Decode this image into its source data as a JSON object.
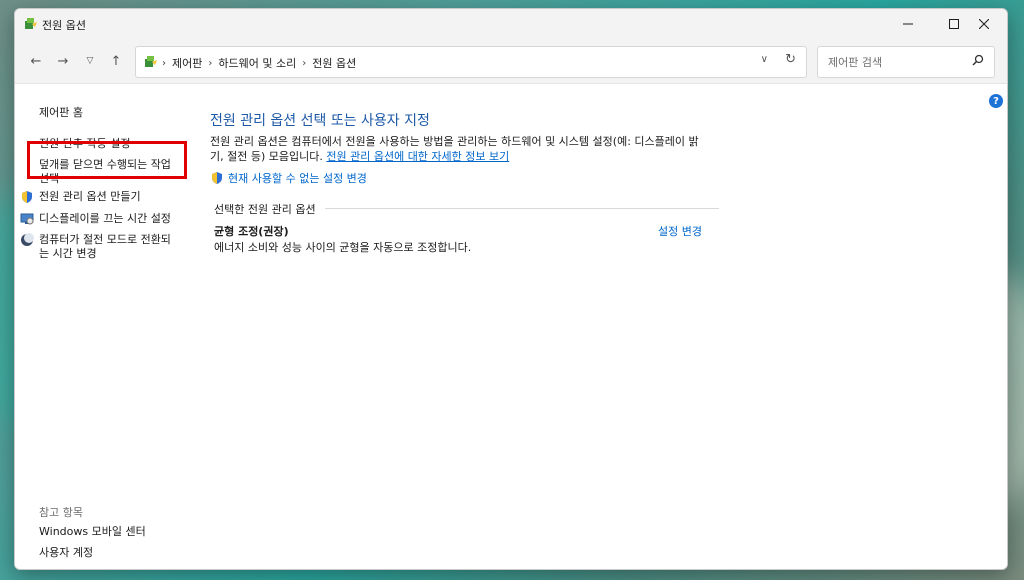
{
  "window": {
    "title": "전원 옵션"
  },
  "address": {
    "crumbs": [
      "제어판",
      "하드웨어 및 소리",
      "전원 옵션"
    ]
  },
  "search": {
    "placeholder": "제어판 검색"
  },
  "sidebar": {
    "home": "제어판 홈",
    "items": [
      {
        "label": "전원 단추 작동 설정"
      },
      {
        "label_line1": "덮개를 닫으면 수행되는 작업",
        "label_line2": "선택"
      },
      {
        "label": "전원 관리 옵션 만들기",
        "icon": "shield-icon"
      },
      {
        "label": "디스플레이를 끄는 시간 설정",
        "icon": "monitor-icon"
      },
      {
        "label_line1": "컴퓨터가 절전 모드로 전환되",
        "label_line2": "는 시간 변경",
        "icon": "moon-icon"
      }
    ],
    "see_also_title": "참고 항목",
    "see_also": [
      "Windows 모바일 센터",
      "사용자 계정"
    ]
  },
  "main": {
    "title": "전원 관리 옵션 선택 또는 사용자 지정",
    "desc_part1": "전원 관리 옵션은 컴퓨터에서 전원을 사용하는 방법을 관리하는 하드웨어 및 시스템 설정(예: 디스플레이 밝",
    "desc_part2": "기, 절전 등) 모음입니다. ",
    "desc_link": "전원 관리 옵션에 대한 자세한 정보 보기",
    "shield_link": "현재 사용할 수 없는 설정 변경",
    "section_title": "선택한 전원 관리 옵션",
    "plan": {
      "name": "균형 조정(권장)",
      "description": "에너지 소비와 성능 사이의 균형을 자동으로 조정합니다.",
      "change_label": "설정 변경"
    }
  },
  "colors": {
    "link": "#0066cc",
    "title": "#1e5aa8",
    "highlight": "#e00000"
  }
}
